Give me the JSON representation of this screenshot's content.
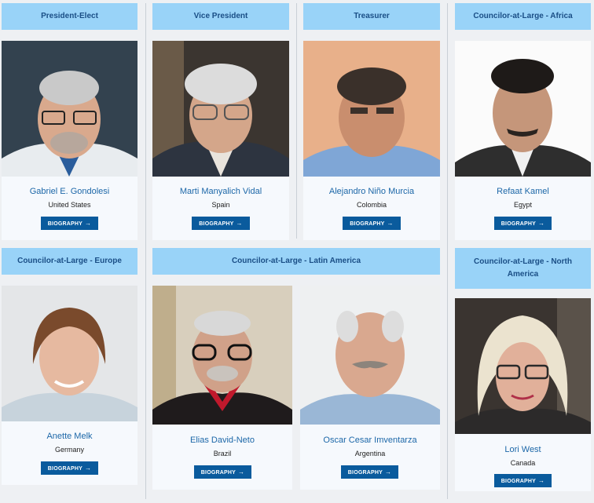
{
  "groups": {
    "president_elect": "President-Elect",
    "vice_president": "Vice President",
    "treasurer": "Treasurer",
    "africa": "Councilor-at-Large - Africa",
    "europe": "Councilor-at-Large - Europe",
    "latin_america": "Councilor-at-Large - Latin America",
    "north_america": "Councilor-at-Large - North America"
  },
  "members": [
    {
      "name": "Gabriel E. Gondolesi",
      "country": "United States",
      "button": "BIOGRAPHY",
      "arrow": "→"
    },
    {
      "name": "Marti Manyalich Vidal",
      "country": "Spain",
      "button": "BIOGRAPHY",
      "arrow": "→"
    },
    {
      "name": "Alejandro Niño Murcia",
      "country": "Colombia",
      "button": "BIOGRAPHY",
      "arrow": "→"
    },
    {
      "name": "Refaat Kamel",
      "country": "Egypt",
      "button": "BIOGRAPHY",
      "arrow": "→"
    },
    {
      "name": "Anette Melk",
      "country": "Germany",
      "button": "BIOGRAPHY",
      "arrow": "→"
    },
    {
      "name": "Elias David-Neto",
      "country": "Brazil",
      "button": "BIOGRAPHY",
      "arrow": "→"
    },
    {
      "name": "Oscar Cesar Imventarza",
      "country": "Argentina",
      "button": "BIOGRAPHY",
      "arrow": "→"
    },
    {
      "name": "Lori West",
      "country": "Canada",
      "button": "BIOGRAPHY",
      "arrow": "→"
    }
  ]
}
